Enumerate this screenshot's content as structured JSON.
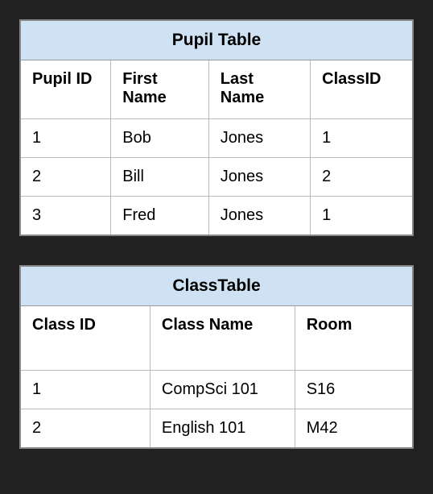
{
  "tables": [
    {
      "title": "Pupil Table",
      "columns": [
        "Pupil ID",
        "First Name",
        "Last Name",
        "ClassID"
      ],
      "rows": [
        [
          "1",
          "Bob",
          "Jones",
          "1"
        ],
        [
          "2",
          "Bill",
          "Jones",
          "2"
        ],
        [
          "3",
          "Fred",
          "Jones",
          "1"
        ]
      ]
    },
    {
      "title": "ClassTable",
      "columns": [
        "Class ID",
        "Class Name",
        "Room"
      ],
      "rows": [
        [
          "1",
          "CompSci 101",
          "S16"
        ],
        [
          "2",
          "English 101",
          "M42"
        ]
      ]
    }
  ]
}
